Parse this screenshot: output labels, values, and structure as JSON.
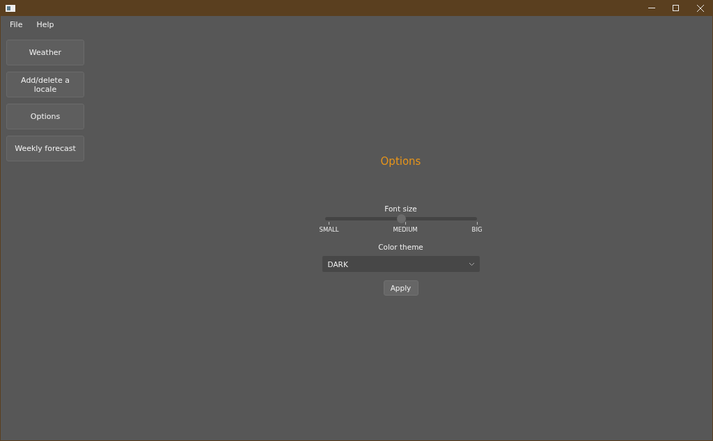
{
  "menu": [
    "File",
    "Help"
  ],
  "nav": [
    "Weather",
    "Add/delete a locale",
    "Options",
    "Weekly forecast"
  ],
  "heading": "Options",
  "font_size": {
    "label": "Font size",
    "level": 0.5,
    "ticks": [
      "SMALL",
      "MEDIUM",
      "BIG"
    ]
  },
  "color_theme": {
    "label": "Color theme",
    "value": "DARK"
  },
  "apply": "Apply"
}
